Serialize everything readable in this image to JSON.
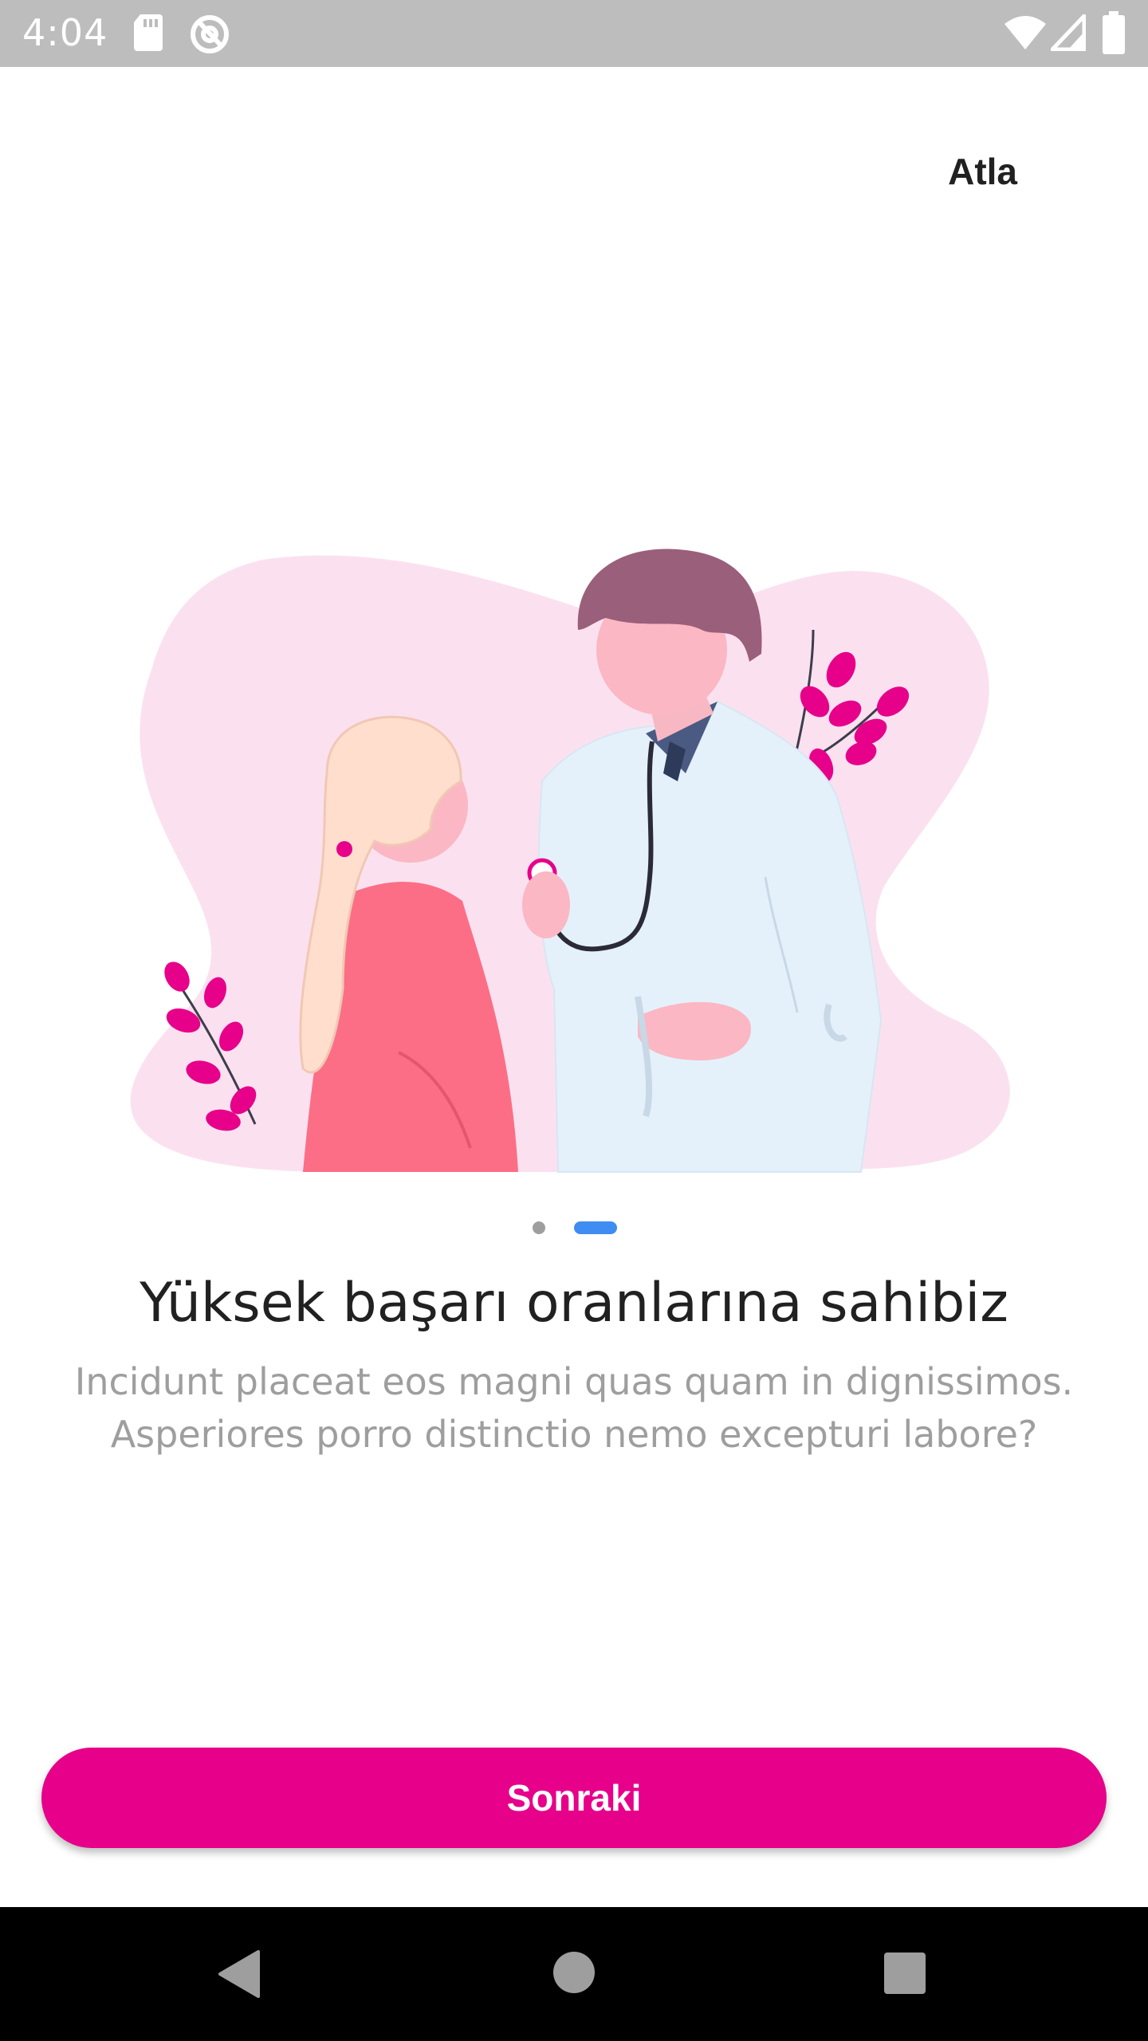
{
  "status_bar": {
    "time": "4:04",
    "icons": [
      "sd-card-icon",
      "sync-icon",
      "wifi-icon",
      "signal-icon",
      "battery-icon"
    ]
  },
  "header": {
    "skip_label": "Atla"
  },
  "slide": {
    "illustration": "doctor-patient-illustration",
    "title": "Yüksek başarı oranlarına sahibiz",
    "description": "Incidunt placeat eos magni quas quam in dignissimos. Asperiores porro distinctio nemo excepturi labore?",
    "page_count": 2,
    "active_page": 2
  },
  "footer": {
    "next_label": "Sonraki"
  },
  "nav_bar": {
    "icons": [
      "back-icon",
      "home-icon",
      "recents-icon"
    ]
  },
  "colors": {
    "accent": "#e6008a",
    "indicator_active": "#3f8cf2",
    "indicator_inactive": "#9e9e9e",
    "status_bar": "#bdbdbd"
  }
}
